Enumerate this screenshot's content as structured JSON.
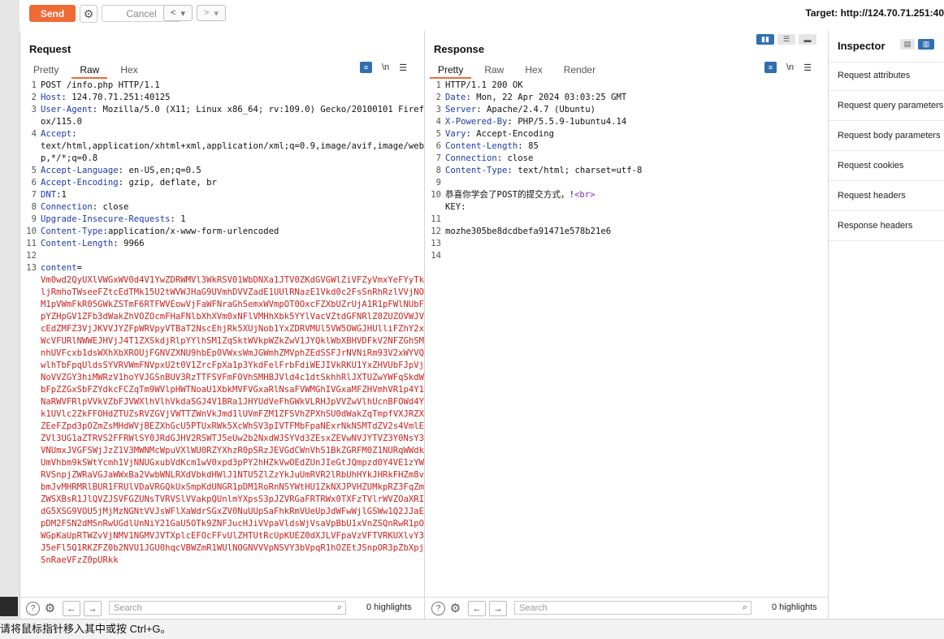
{
  "toolbar": {
    "send_label": "Send",
    "cancel_label": "Cancel",
    "back_label": "<",
    "back_dropdown": "▾",
    "forward_label": ">",
    "forward_dropdown": "▾",
    "target_label": "Target: http://124.70.71.251:40",
    "send_color": "#f06a35"
  },
  "request": {
    "title": "Request",
    "tabs": [
      "Pretty",
      "Raw",
      "Hex"
    ],
    "active_tab": "Raw",
    "newline_label": "\\n",
    "lines": [
      {
        "n": "1",
        "key": "",
        "sep": "",
        "val": "POST /info.php HTTP/1.1"
      },
      {
        "n": "2",
        "key": "Host",
        "sep": ": ",
        "val": "124.70.71.251:40125"
      },
      {
        "n": "3",
        "key": "User-Agent",
        "sep": ": ",
        "val": "Mozilla/5.0 (X11; Linux x86_64; rv:109.0) Gecko/20100101 Firefox/115.0"
      },
      {
        "n": "4",
        "key": "Accept",
        "sep": ":",
        "val": "\ntext/html,application/xhtml+xml,application/xml;q=0.9,image/avif,image/webp,*/*;q=0.8"
      },
      {
        "n": "5",
        "key": "Accept-Language",
        "sep": ": ",
        "val": "en-US,en;q=0.5"
      },
      {
        "n": "6",
        "key": "Accept-Encoding",
        "sep": ": ",
        "val": "gzip, deflate, br"
      },
      {
        "n": "7",
        "key": "DNT",
        "sep": ":",
        "val": "1"
      },
      {
        "n": "8",
        "key": "Connection",
        "sep": ": ",
        "val": "close"
      },
      {
        "n": "9",
        "key": "Upgrade-Insecure-Requests",
        "sep": ": ",
        "val": "1"
      },
      {
        "n": "10",
        "key": "Content-Type",
        "sep": ":",
        "val": "application/x-www-form-urlencoded"
      },
      {
        "n": "11",
        "key": "Content-Length",
        "sep": ": ",
        "val": "9966"
      },
      {
        "n": "12",
        "key": "",
        "sep": "",
        "val": ""
      },
      {
        "n": "13",
        "key": "content",
        "sep": "=",
        "val": ""
      }
    ],
    "body": "Vm0wd2QyUXlVWGxWV0d4V1YwZDRWMVl3WkRSV01WbDNXa1JTV0ZKdGVGWlZiVFZyVmxYeFYyTkljRmhoTWseeFZtcEdTMk15U2tWVWJHaG9UVmhDVVZadE1UUlRNazE1Vkd0c2FsSnRhRzlVVjNOM1pVWmFkR05GWkZSTmF6RTFWVEowVjFaWFNraGhSemxWVmpOT0OxcFZXbUZrUjA1R1pFWlNUbFpYZHpGV1ZFb3dWakZhVOZOcmFHaFNlbXhXVm0xNFlVMHhXbk5YYlVacVZtdGFNRlZ0ZUZOVWJVcEdZMFZ3VjJKVVJYZFpWRVpyVTBaT2NscEhjRk5XUjNob1YxZDRVMUl5VW5OWGJHUlliFZhY2xWcVFURlNWWEJHVjJ4T1ZXSkdjRlpYYlhSM1ZqSktWVkpWZkZwV1JYQklWbXBHVDFkV2NFZGhSMnhUVFcxb1dsWXhXbXROUjFGNVZXNU9hbEp0VWxsWmJGWmhZMVphZEdSSFJrNVNiRm93V2xWYVQwlhTbFpqUldsSYVRVWmFNVpxU2t0V1ZrcFpXa1p3YkdFelFrbFdiWEJIVkRKU1YxZHVUbFJpVjNoVVZGY3hiMWRzV1hoYVJGSnBUV3RzTTFSVFmFOVhSMHBJVld4c1dtSkhhRlJXTUZwYWFqSkdWbFpZZGxSbFZYdkcFCZqTm9WVlpHWTNoaU1XbkMVFVGxaRlNsaFVWMGhIVGxaMFZHVmhVR1p4Y1NaRWVFRlpVVkVZbFJVWXlhVlhVkdaSGJ4V1BRa1JHYUdVeFhGWkVLRHJpVVZwVlhUcnBFOWd4Yk1UVlc2ZkFFOHdZTUZsRVZGVjVWTTZWnVkJmd1lUVmFZM1ZFSVhZPXhSU0dWakZqTmpfVXJRZXZEeFZpd3pOZmZsMHdWVjBEZXhGcU5PTUxRWk5XcWhSV3pIVTFMbFpaNExrNkNSMTdZV2s4VmlEZVl3UG1aZTRVS2FFRWlSY0JRdGJHV2RSWTJ5eUw2b2NxdWJSYVd3ZEsxZEVwNVJYTVZ3Y0NsY3VNUmxJVGFSWjJzZ1V3MWNMcWpuVXlWU0RZYXhzR0pSRzJEVGdCWnVhS1BkZGRFM0Z1NURqWWdkUmVhbm9kSWtYcmh1VjNNUGxubVdKcm1wV0xpd3pPY2hHZkVwOEdZUnJIeGtJQmpzd0Y4VE1zYWRVSnpjZWRaVGJaWWxBa2VwbWNLRXdVbkdHWlJ1NTU5ZlZzYkJuUmRVR2lRbUhHYkJHRkFHZm8vbmJvMHRMRlBUR1FRUlVDaVRGQkUxSmpKdUNGR1pDM1RoRnNSYWtHU1ZkNXJPVHZUMkpRZ3FqZmZWSXBsR1JlQVZJSVFGZUNsTVRVSlVVakpQUnlmYXpsS3pJZVRGaFRTRWx0TXFzTVlrWVZOaXRIdG5XSG9VOU5jMjMzNGNtVVJsWFlXaWdrSGxZV0NuUUpSaFhkRmVUeUpJdWFwWjlGSWw1Q2JJaEpDM2FSN2dMSnRwUGdlUnNiY21GaU5OTk9ZNFJucHJiVVpaVldsWjVsaVpBbU1xVnZSQnRwR1pOWGpKaUpRTWZvVjNMV1NGMVJVTXplcEFOcFFvUlZHTUtRcUpKUEZ0dXJLVFpaVzVFTVRKUXlvY3J5eFl5Q1RKZFZ0b2NVU1JGU0hqcVBWZmR1WUlNOGNVVVpNSVY3bVpqR1hOZEtJSnpOR3pZbXpjSnRaeVFzZ0pURkk"
  },
  "response": {
    "title": "Response",
    "tabs": [
      "Pretty",
      "Raw",
      "Hex",
      "Render"
    ],
    "active_tab": "Pretty",
    "newline_label": "\\n",
    "lines": [
      {
        "n": "1",
        "key": "",
        "sep": "",
        "val": "HTTP/1.1 200 OK"
      },
      {
        "n": "2",
        "key": "Date",
        "sep": ": ",
        "val": "Mon, 22 Apr 2024 03:03:25 GMT"
      },
      {
        "n": "3",
        "key": "Server",
        "sep": ": ",
        "val": "Apache/2.4.7 (Ubuntu)"
      },
      {
        "n": "4",
        "key": "X-Powered-By",
        "sep": ": ",
        "val": "PHP/5.5.9-1ubuntu4.14"
      },
      {
        "n": "5",
        "key": "Vary",
        "sep": ": ",
        "val": "Accept-Encoding"
      },
      {
        "n": "6",
        "key": "Content-Length",
        "sep": ": ",
        "val": "85"
      },
      {
        "n": "7",
        "key": "Connection",
        "sep": ": ",
        "val": "close"
      },
      {
        "n": "8",
        "key": "Content-Type",
        "sep": ": ",
        "val": "text/html; charset=utf-8"
      },
      {
        "n": "9",
        "key": "",
        "sep": "",
        "val": ""
      },
      {
        "n": "10",
        "key": "",
        "sep": "",
        "val": "恭喜你学会了POST的提交方式，!<br>\nKEY:"
      },
      {
        "n": "11",
        "key": "",
        "sep": "",
        "val": ""
      },
      {
        "n": "12",
        "key": "",
        "sep": "",
        "val": "mozhe305be8dcdbefa91471e578b21e6"
      },
      {
        "n": "13",
        "key": "",
        "sep": "",
        "val": ""
      },
      {
        "n": "14",
        "key": "",
        "sep": "",
        "val": ""
      }
    ]
  },
  "inspector": {
    "title": "Inspector",
    "items": [
      "Request attributes",
      "Request query parameters",
      "Request body parameters",
      "Request cookies",
      "Request headers",
      "Response headers"
    ]
  },
  "footer": {
    "search_placeholder": "Search",
    "highlights_label": "0 highlights",
    "help_label": "?",
    "back_label": "←",
    "forward_label": "→"
  },
  "statusbar": {
    "text": "请将鼠标指针移入其中或按 Ctrl+G。"
  }
}
